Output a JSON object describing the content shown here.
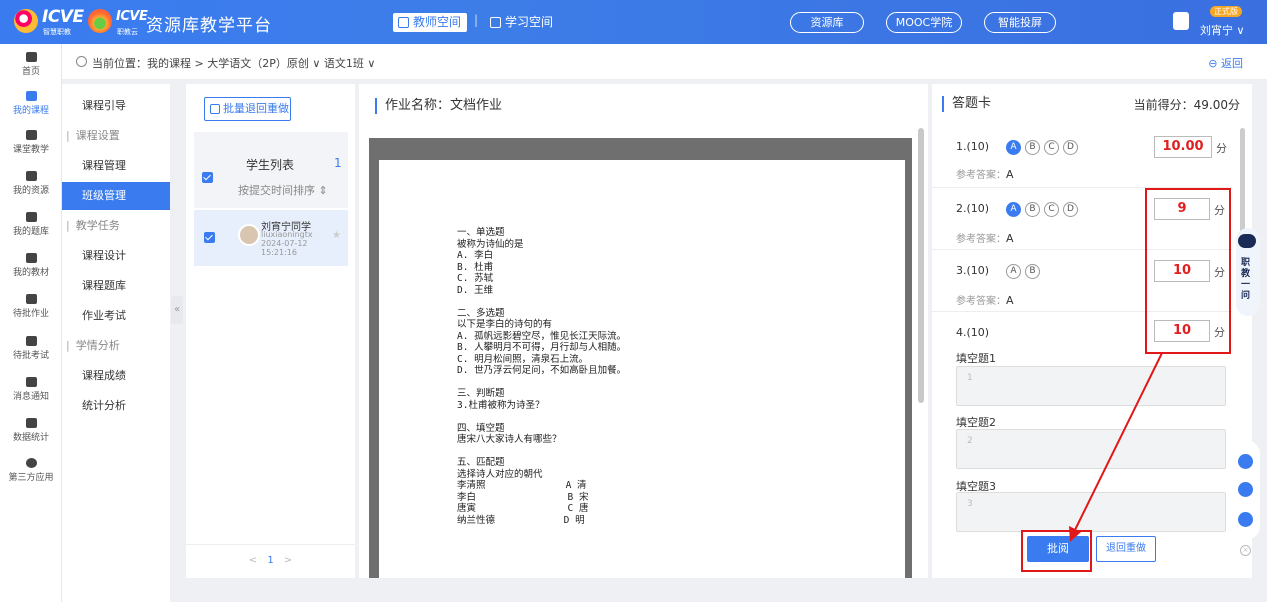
{
  "header": {
    "logo1": {
      "text": "ICVE",
      "sub": "智慧职教"
    },
    "logo2": {
      "text": "ICVE",
      "sub": "职教云"
    },
    "title": "资源库教学平台",
    "nav_teacher": "教师空间",
    "nav_sep": "|",
    "nav_student": "学习空间",
    "pill_resource": "资源库",
    "pill_mooc": "MOOC学院",
    "pill_screen": "智能投屏",
    "user_badge": "正式版",
    "user_name": "刘宵宁 ∨"
  },
  "rail": {
    "items": [
      "首页",
      "我的课程",
      "课堂教学",
      "我的资源",
      "我的题库",
      "我的教材",
      "待批作业",
      "待批考试",
      "消息通知",
      "数据统计",
      "第三方应用"
    ]
  },
  "breadcrumb": {
    "text": "当前位置：我的课程 > 大学语文（2P）原创 ∨  语文1班 ∨",
    "back": "返回"
  },
  "subnav": {
    "items": [
      {
        "label": "课程引导",
        "type": "item"
      },
      {
        "label": "课程设置",
        "type": "group"
      },
      {
        "label": "课程管理",
        "type": "item"
      },
      {
        "label": "班级管理",
        "type": "active"
      },
      {
        "label": "教学任务",
        "type": "group"
      },
      {
        "label": "课程设计",
        "type": "item"
      },
      {
        "label": "课程题库",
        "type": "item"
      },
      {
        "label": "作业考试",
        "type": "item"
      },
      {
        "label": "学情分析",
        "type": "group"
      },
      {
        "label": "课程成绩",
        "type": "item"
      },
      {
        "label": "统计分析",
        "type": "item"
      }
    ],
    "collapse": "«"
  },
  "students": {
    "batch_button": "批量退回重做",
    "list_title": "学生列表",
    "count": "1",
    "sort": "按提交时间排序 ⇕",
    "student_name": "刘宵宁同学",
    "student_id": "liuxiaoningtx",
    "student_time": "2024-07-12 15:21:16",
    "star": "★",
    "pager_prev": "<",
    "pager_page": "1",
    "pager_next": ">"
  },
  "document": {
    "homework_title": "作业名称：文档作业",
    "lines": [
      "一、单选题",
      "被称为诗仙的是",
      "A. 李白",
      "B. 杜甫",
      "C. 苏轼",
      "D. 王维",
      "",
      "二、多选题",
      "以下是李白的诗句的有",
      "A. 孤帆远影碧空尽，惟见长江天际流。",
      "B. 人攀明月不可得，月行却与人相随。",
      "C. 明月松间照，清泉石上流。",
      "D. 世乃浮云何足问，不如高卧且加餐。",
      "",
      "三、判断题",
      "3.杜甫被称为诗圣？",
      "",
      "四、填空题",
      "唐宋八大家诗人有哪些？",
      "",
      "五、匹配题",
      "选择诗人对应的朝代",
      "李清照              A 清",
      "李白                B 宋",
      "唐寅                C 唐",
      "纳兰性德            D 明"
    ]
  },
  "card": {
    "title": "答题卡",
    "current_score": "当前得分：49.00分",
    "questions": [
      {
        "num": "1.(10)",
        "options": [
          "A",
          "B",
          "C",
          "D"
        ],
        "selected": "A",
        "ref_label": "参考答案：",
        "ref": "A",
        "score": "10.00"
      },
      {
        "num": "2.(10)",
        "options": [
          "A",
          "B",
          "C",
          "D"
        ],
        "selected": "A",
        "ref_label": "参考答案：",
        "ref": "A",
        "score": "9"
      },
      {
        "num": "3.(10)",
        "options": [
          "A",
          "B"
        ],
        "selected": "",
        "ref_label": "参考答案：",
        "ref": "A",
        "score": "10"
      },
      {
        "num": "4.(10)",
        "options": [],
        "selected": "",
        "ref_label": "",
        "ref": "",
        "score": "10"
      }
    ],
    "unit": "分",
    "blanks": [
      {
        "label": "填空题1",
        "value": "1"
      },
      {
        "label": "填空题2",
        "value": "2"
      },
      {
        "label": "填空题3",
        "value": "3"
      }
    ],
    "review_button": "批阅",
    "return_button": "退回重做"
  },
  "float": {
    "assistant": "职教一问"
  },
  "colors": {
    "primary": "#3a7cf0",
    "highlight": "#e01818"
  }
}
